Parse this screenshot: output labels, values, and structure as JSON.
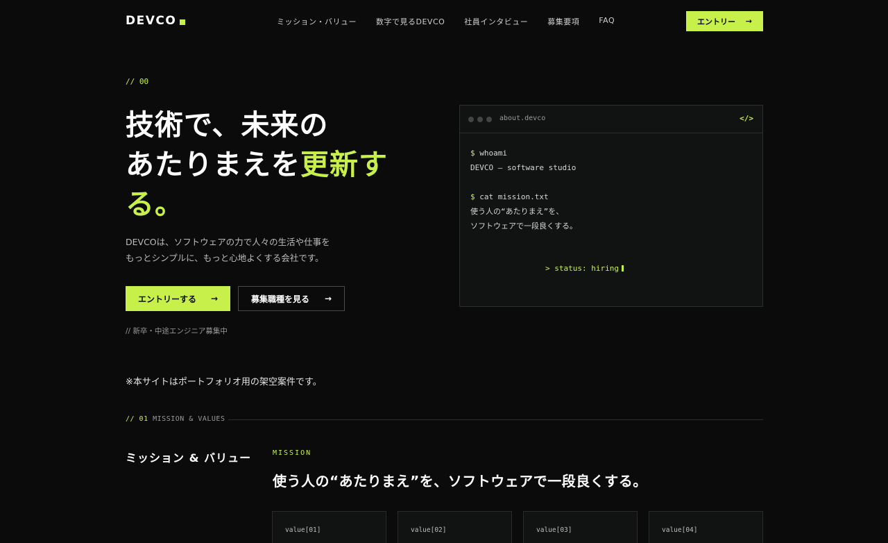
{
  "header": {
    "logo": "DEVCO",
    "nav": [
      "ミッション・バリュー",
      "数字で見るDEVCO",
      "社員インタビュー",
      "募集要項",
      "FAQ"
    ],
    "entry_label": "エントリー",
    "entry_arrow": "→"
  },
  "hero": {
    "section_tag": "// 00",
    "title_line1": "技術で、未来の",
    "title_line2_plain": "あたりまえを",
    "title_line2_accent": "更新す",
    "title_line3_accent": "る。",
    "desc_line1": "DEVCOは、ソフトウェアの力で人々の生活や仕事を",
    "desc_line2": "もっとシンプルに、もっと心地よくする会社です。",
    "primary_button": "エントリーする",
    "secondary_button": "募集職種を見る",
    "arrow": "→",
    "note": "// 新卒・中途エンジニア募集中"
  },
  "terminal": {
    "title": "about.devco",
    "code_icon": "</>",
    "prompt": "$",
    "cmd1": "whoami",
    "out1": "DEVCO — software studio",
    "cmd2": "cat mission.txt",
    "out2_line1": "使う人の“あたりまえ”を、",
    "out2_line2": "ソフトウェアで一段良くする。",
    "status": "> status: hiring"
  },
  "disclaimer": "※本サイトはポートフォリオ用の架空案件です。",
  "mission": {
    "tag_num": "// 01",
    "tag_text": "MISSION & VALUES",
    "heading": "ミッション & バリュー",
    "label": "MISSION",
    "statement": "使う人の“あたりまえ”を、ソフトウェアで一段良くする。",
    "values": [
      "value[01]",
      "value[02]",
      "value[03]",
      "value[04]"
    ]
  },
  "colors": {
    "accent": "#c8f04a",
    "background": "#0b0b0b"
  }
}
